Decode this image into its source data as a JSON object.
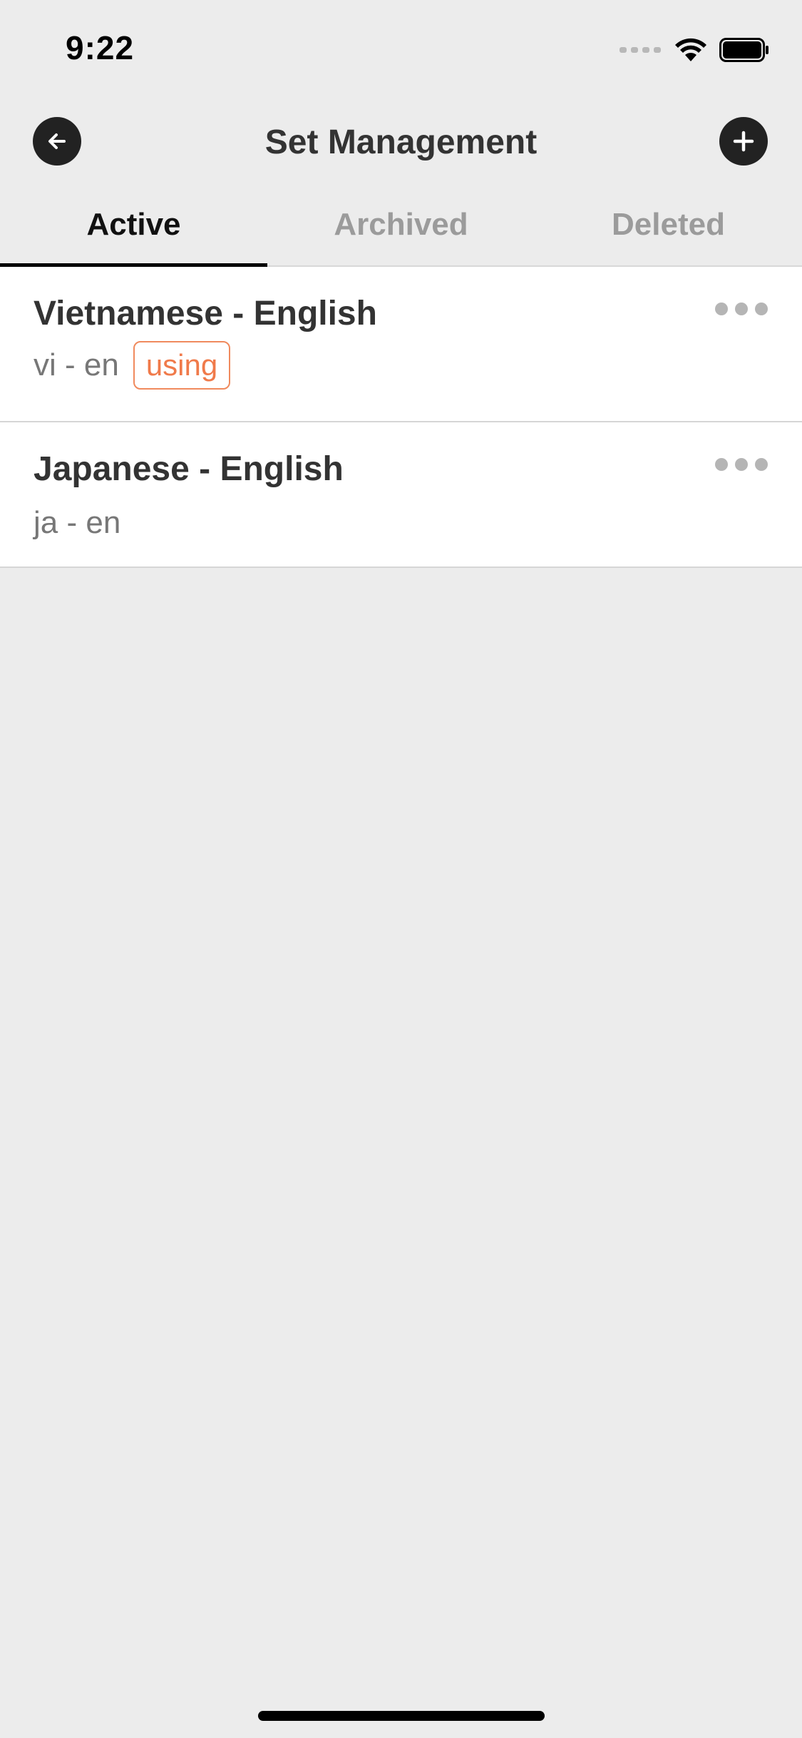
{
  "status_bar": {
    "time": "9:22"
  },
  "header": {
    "title": "Set Management",
    "back_icon": "arrow-left-icon",
    "add_icon": "plus-icon"
  },
  "tabs": [
    {
      "label": "Active",
      "selected": true
    },
    {
      "label": "Archived",
      "selected": false
    },
    {
      "label": "Deleted",
      "selected": false
    }
  ],
  "sets": [
    {
      "name": "Vietnamese - English",
      "code": "vi - en",
      "badge": "using"
    },
    {
      "name": "Japanese - English",
      "code": "ja - en",
      "badge": ""
    }
  ],
  "colors": {
    "accent": "#f07a4a",
    "background": "#ececec",
    "tab_active": "#111111",
    "tab_inactive": "#9b9b9b"
  }
}
